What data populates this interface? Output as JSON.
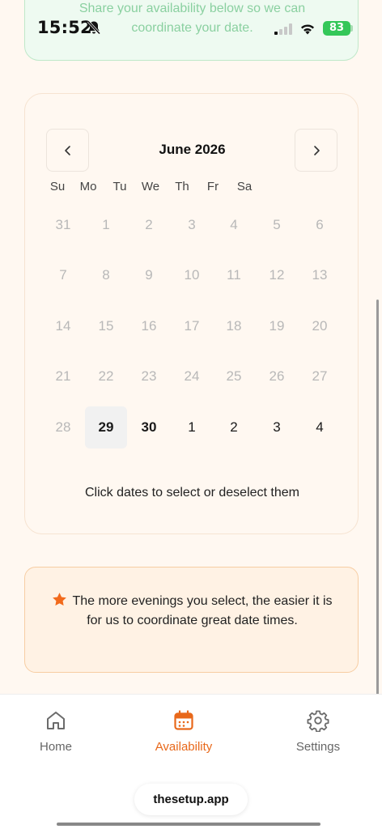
{
  "status_bar": {
    "time": "15:52",
    "battery": "83"
  },
  "info_card": {
    "text": "Share your availability below so we can coordinate your date."
  },
  "calendar": {
    "month_title": "June 2026",
    "weekdays": [
      "Su",
      "Mo",
      "Tu",
      "We",
      "Th",
      "Fr",
      "Sa"
    ],
    "weeks": [
      [
        "31",
        "1",
        "2",
        "3",
        "4",
        "5",
        "6"
      ],
      [
        "7",
        "8",
        "9",
        "10",
        "11",
        "12",
        "13"
      ],
      [
        "14",
        "15",
        "16",
        "17",
        "18",
        "19",
        "20"
      ],
      [
        "21",
        "22",
        "23",
        "24",
        "25",
        "26",
        "27"
      ],
      [
        "28",
        "29",
        "30",
        "1",
        "2",
        "3",
        "4"
      ]
    ],
    "today": "29",
    "hint": "Click dates to select or deselect them"
  },
  "tip": {
    "text": "The more evenings you select, the easier it is for us to coordinate great date times."
  },
  "bottom_nav": {
    "items": [
      {
        "label": "Home",
        "icon": "home-icon",
        "active": false
      },
      {
        "label": "Availability",
        "icon": "calendar-icon",
        "active": true
      },
      {
        "label": "Settings",
        "icon": "gear-icon",
        "active": false
      }
    ]
  },
  "url": "thesetup.app",
  "colors": {
    "accent": "#e8681a",
    "background": "#fff8f1",
    "tip_background": "#fff2e4",
    "success": "#34c759"
  }
}
